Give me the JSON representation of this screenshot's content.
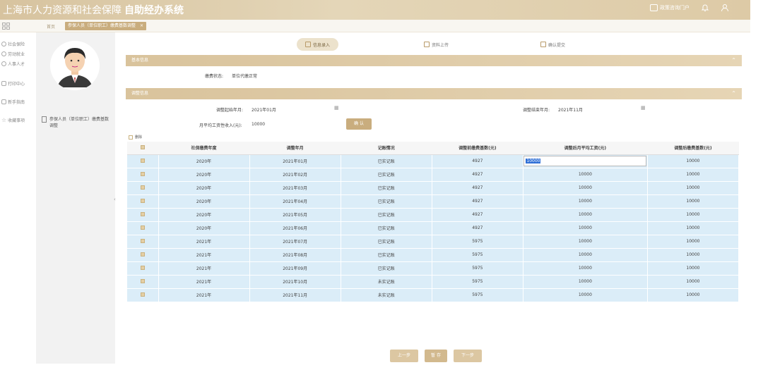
{
  "header": {
    "title_main": "上海市人力资源和社会保障",
    "title_bold": "自助经办系统",
    "service": "政策咨询门户"
  },
  "tabbar": {
    "home": "首页",
    "active_tab": "参保人员（单位职工）缴费基数调整",
    "close": "×"
  },
  "leftnav": {
    "items": [
      {
        "label": "社会保险",
        "icon": "shield-icon"
      },
      {
        "label": "劳动就业",
        "icon": "worker-icon"
      },
      {
        "label": "人事人才",
        "icon": "person-icon"
      },
      {
        "label": "打印中心",
        "icon": "printer-icon"
      },
      {
        "label": "新手指南",
        "icon": "guide-icon"
      },
      {
        "label": "收藏事项",
        "icon": "star-icon"
      }
    ]
  },
  "profile": {
    "link_label": "参保人员（单位职工）缴费基数调整"
  },
  "steps": [
    {
      "label": "信息录入",
      "active": true
    },
    {
      "label": "资料上传",
      "active": false
    },
    {
      "label": "确认提交",
      "active": false
    }
  ],
  "section1": {
    "title": "基本信息",
    "status_label": "缴费状态:",
    "status_value": "单位代缴正常"
  },
  "section2": {
    "title": "调整信息",
    "start_label": "调整起始年月:",
    "start_value": "2021年01月",
    "end_label": "调整结束年月:",
    "end_value": "2021年11月",
    "income_label": "月平均工资性收入(元):",
    "income_value": "10000",
    "confirm_button": "确 认",
    "delete_label": "删除"
  },
  "table": {
    "headers": [
      "社保缴费年度",
      "调整年月",
      "记账情况",
      "调整前缴费基数(元)",
      "调整后月平均工资(元)",
      "调整后缴费基数(元)"
    ],
    "rows": [
      [
        "2020年",
        "2021年01月",
        "已实记账",
        "4927",
        "10000",
        "10000"
      ],
      [
        "2020年",
        "2021年02月",
        "已实记账",
        "4927",
        "10000",
        "10000"
      ],
      [
        "2020年",
        "2021年03月",
        "已实记账",
        "4927",
        "10000",
        "10000"
      ],
      [
        "2020年",
        "2021年04月",
        "已实记账",
        "4927",
        "10000",
        "10000"
      ],
      [
        "2020年",
        "2021年05月",
        "已实记账",
        "4927",
        "10000",
        "10000"
      ],
      [
        "2020年",
        "2021年06月",
        "已实记账",
        "4927",
        "10000",
        "10000"
      ],
      [
        "2021年",
        "2021年07月",
        "已实记账",
        "5975",
        "10000",
        "10000"
      ],
      [
        "2021年",
        "2021年08月",
        "已实记账",
        "5975",
        "10000",
        "10000"
      ],
      [
        "2021年",
        "2021年09月",
        "已实记账",
        "5975",
        "10000",
        "10000"
      ],
      [
        "2021年",
        "2021年10月",
        "未实记账",
        "5975",
        "10000",
        "10000"
      ],
      [
        "2021年",
        "2021年11月",
        "未实记账",
        "5975",
        "10000",
        "10000"
      ]
    ]
  },
  "footer": {
    "prev": "上一步",
    "save": "暂 存",
    "next": "下一步"
  },
  "colors": {
    "accent": "#c9ad7e",
    "header": "#d7c39f",
    "row_bg": "#dbedf8"
  }
}
